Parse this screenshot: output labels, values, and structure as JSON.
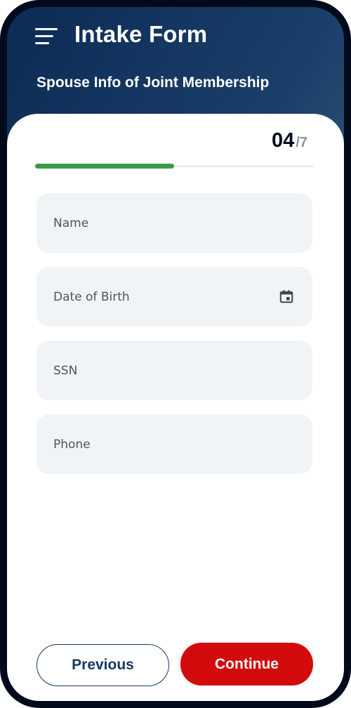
{
  "header": {
    "app_title": "Intake Form",
    "section_title": "Spouse Info of Joint Membership"
  },
  "progress": {
    "current_step": "04",
    "total_steps": "/7",
    "fraction": 0.5
  },
  "form": {
    "fields": [
      {
        "placeholder": "Name",
        "value": ""
      },
      {
        "placeholder": "Date of Birth",
        "value": "",
        "icon": "calendar-icon"
      },
      {
        "placeholder": "SSN",
        "value": ""
      },
      {
        "placeholder": "Phone",
        "value": ""
      }
    ]
  },
  "actions": {
    "previous_label": "Previous",
    "continue_label": "Continue"
  },
  "colors": {
    "header_gradient_start": "#0c2b55",
    "header_gradient_end": "#5a7893",
    "progress": "#3a9b4c",
    "continue_button": "#d40b0d",
    "previous_border": "#173a60"
  }
}
